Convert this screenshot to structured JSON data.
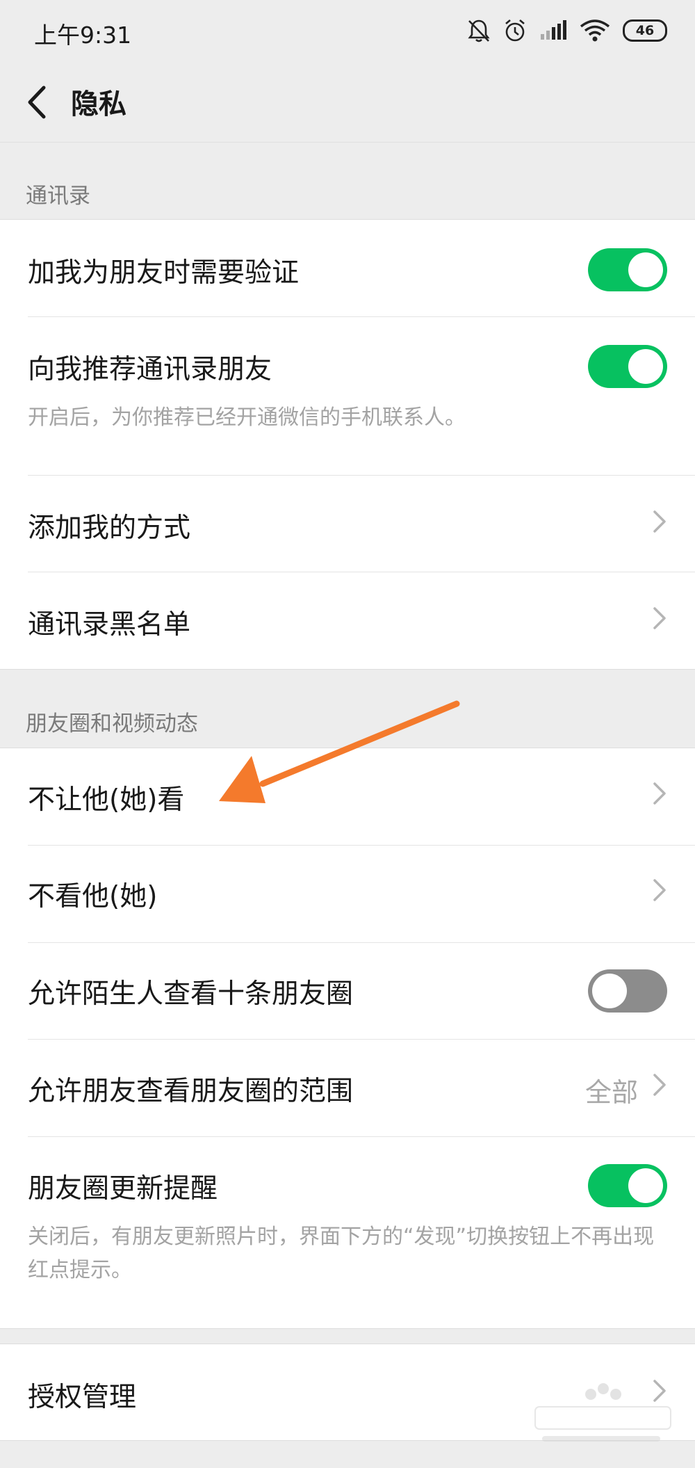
{
  "status_bar": {
    "time": "上午9:31",
    "battery_level": "46",
    "icons": [
      "mute-bell-icon",
      "alarm-icon",
      "signal-icon",
      "wifi-icon",
      "battery-icon"
    ]
  },
  "nav": {
    "title": "隐私",
    "back_icon": "chevron-left-icon"
  },
  "sections": {
    "contacts": {
      "label": "通讯录",
      "items": [
        {
          "title": "加我为朋友时需要验证",
          "toggle": true
        },
        {
          "title": "向我推荐通讯录朋友",
          "toggle": true,
          "description": "开启后，为你推荐已经开通微信的手机联系人。"
        },
        {
          "title": "添加我的方式"
        },
        {
          "title": "通讯录黑名单"
        }
      ]
    },
    "moments": {
      "label": "朋友圈和视频动态",
      "items": [
        {
          "title": "不让他(她)看"
        },
        {
          "title": "不看他(她)"
        },
        {
          "title": "允许陌生人查看十条朋友圈",
          "toggle": false
        },
        {
          "title": "允许朋友查看朋友圈的范围",
          "value": "全部"
        },
        {
          "title": "朋友圈更新提醒",
          "toggle": true,
          "description": "关闭后，有朋友更新照片时，界面下方的“发现”切换按钮上不再出现红点提示。"
        }
      ]
    },
    "auth": {
      "items": [
        {
          "title": "授权管理"
        }
      ]
    }
  },
  "colors": {
    "toggle_on": "#07c160",
    "toggle_off": "#8c8c8c",
    "annotation_arrow": "#f47a2c",
    "background": "#ededed"
  }
}
